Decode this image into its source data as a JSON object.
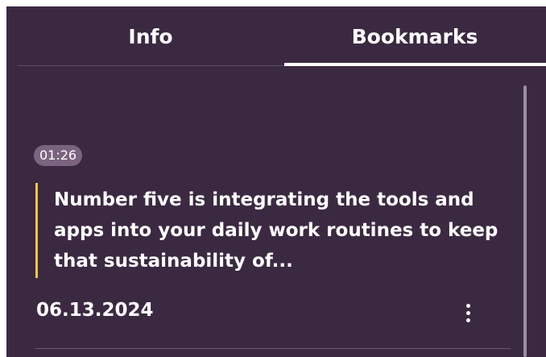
{
  "tabs": {
    "info_label": "Info",
    "bookmarks_label": "Bookmarks",
    "active": "Bookmarks"
  },
  "bookmarks": [
    {
      "timestamp": "01:26",
      "text": "Number five is integrating the tools and apps into your daily work routines to keep that sustainability of...",
      "date": "06.13.2024",
      "menu_icon": "more-vertical-icon"
    }
  ],
  "colors": {
    "panel_background": "#3b2941",
    "accent_quote_bar": "#f2c94c",
    "timestamp_chip": "#7b6480",
    "text": "#ffffff"
  }
}
